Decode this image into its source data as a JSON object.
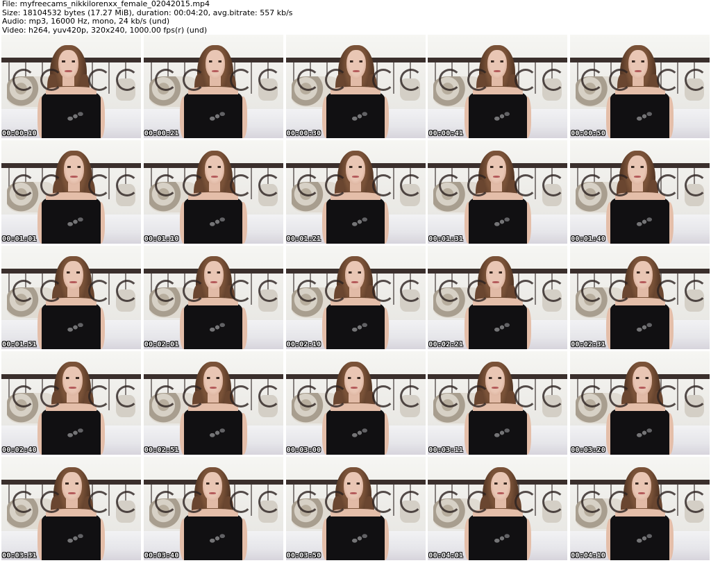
{
  "header": {
    "file_line": "File: myfreecams_nikkilorenxx_female_02042015.mp4",
    "size_line": "Size: 18104532 bytes (17.27 MiB), duration: 00:04:20, avg.bitrate: 557 kb/s",
    "audio_line": "Audio: mp3, 16000 Hz, mono, 24 kb/s (und)",
    "video_line": "Video: h264, yuv420p, 320x240, 1000.00 fps(r) (und)"
  },
  "thumbnails": [
    {
      "timestamp": "00:00:10"
    },
    {
      "timestamp": "00:00:21"
    },
    {
      "timestamp": "00:00:30"
    },
    {
      "timestamp": "00:00:41"
    },
    {
      "timestamp": "00:00:50"
    },
    {
      "timestamp": "00:01:01"
    },
    {
      "timestamp": "00:01:10"
    },
    {
      "timestamp": "00:01:21"
    },
    {
      "timestamp": "00:01:31"
    },
    {
      "timestamp": "00:01:40"
    },
    {
      "timestamp": "00:01:51"
    },
    {
      "timestamp": "00:02:01"
    },
    {
      "timestamp": "00:02:10"
    },
    {
      "timestamp": "00:02:21"
    },
    {
      "timestamp": "00:02:31"
    },
    {
      "timestamp": "00:02:40"
    },
    {
      "timestamp": "00:02:51"
    },
    {
      "timestamp": "00:03:00"
    },
    {
      "timestamp": "00:03:11"
    },
    {
      "timestamp": "00:03:20"
    },
    {
      "timestamp": "00:03:31"
    },
    {
      "timestamp": "00:03:40"
    },
    {
      "timestamp": "00:03:50"
    },
    {
      "timestamp": "00:04:01"
    },
    {
      "timestamp": "00:04:10"
    }
  ]
}
